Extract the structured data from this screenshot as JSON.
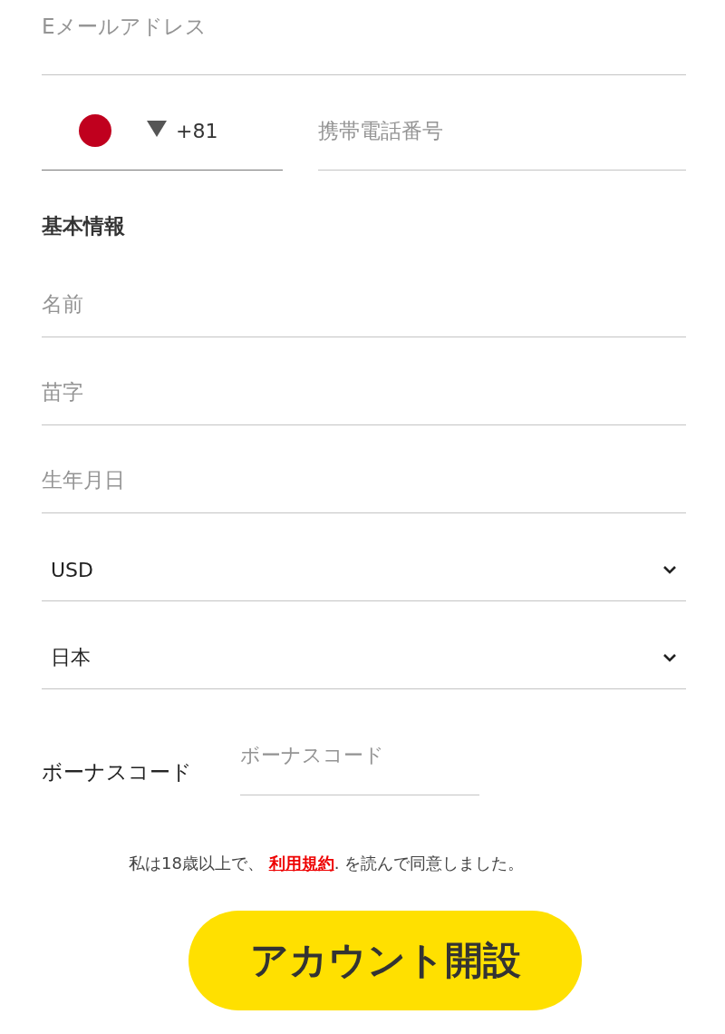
{
  "email": {
    "placeholder": "Eメールアドレス"
  },
  "phone": {
    "country_code": "+81",
    "placeholder": "携帯電話番号"
  },
  "section_title": "基本情報",
  "fields": [
    {
      "kind": "text",
      "placeholder": "名前"
    },
    {
      "kind": "text",
      "placeholder": "苗字"
    },
    {
      "kind": "text",
      "placeholder": "生年月日"
    },
    {
      "kind": "select",
      "value": "USD"
    },
    {
      "kind": "select",
      "value": "日本"
    }
  ],
  "bonus": {
    "label": "ボーナスコード",
    "placeholder": "ボーナスコード"
  },
  "consent": {
    "before": "私は18歳以上で、 ",
    "link": "利用規約",
    "after": ". を読んで同意しました。"
  },
  "submit": "アカウント開設"
}
